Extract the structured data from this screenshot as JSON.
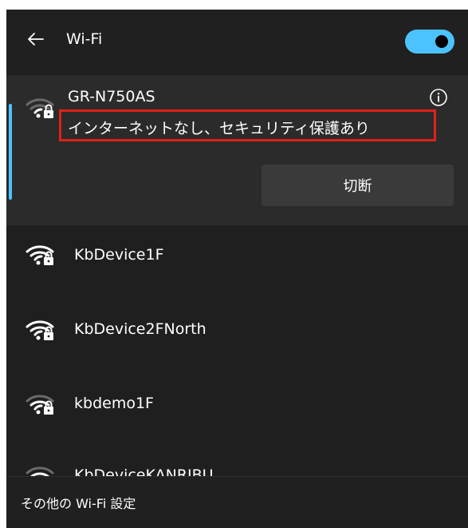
{
  "header": {
    "title": "Wi-Fi",
    "back_icon": "arrow-left-icon",
    "wifi_enabled": true
  },
  "connected_network": {
    "name": "GR-N750AS",
    "status": "インターネットなし、セキュリティ保護あり",
    "disconnect_label": "切断",
    "info_icon": "info-icon"
  },
  "networks": [
    {
      "name": "KbDevice1F"
    },
    {
      "name": "KbDevice2FNorth"
    },
    {
      "name": "kbdemo1F"
    },
    {
      "name": "KbDeviceKANRIBU"
    }
  ],
  "footer": {
    "settings_link": "その他の Wi-Fi 設定"
  },
  "colors": {
    "accent": "#4cc2ff",
    "panel_bg": "#1f1f1f",
    "selected_bg": "#2b2b2b",
    "highlight_border": "#e0201a"
  }
}
